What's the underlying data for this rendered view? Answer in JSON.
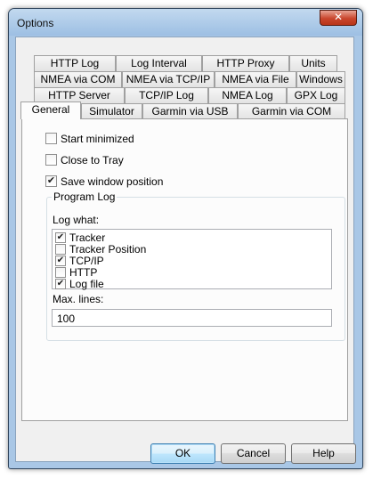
{
  "window": {
    "title": "Options",
    "close_glyph": "✕"
  },
  "tabs": {
    "row1": [
      "HTTP Log",
      "Log Interval",
      "HTTP Proxy",
      "Units"
    ],
    "row2": [
      "NMEA via COM",
      "NMEA via TCP/IP",
      "NMEA via File",
      "Windows"
    ],
    "row3": [
      "HTTP Server",
      "TCP/IP Log",
      "NMEA Log",
      "GPX Log"
    ],
    "row4": [
      "General",
      "Simulator",
      "Garmin via USB",
      "Garmin via COM"
    ],
    "active": "General"
  },
  "general": {
    "start_minimized": {
      "label": "Start minimized",
      "checked": false
    },
    "close_to_tray": {
      "label": "Close to Tray",
      "checked": false
    },
    "save_window_position": {
      "label": "Save window position",
      "checked": true
    }
  },
  "program_log": {
    "title": "Program Log",
    "log_what_label": "Log what:",
    "items": [
      {
        "label": "Tracker",
        "checked": true
      },
      {
        "label": "Tracker Position",
        "checked": false
      },
      {
        "label": "TCP/IP",
        "checked": true
      },
      {
        "label": "HTTP",
        "checked": false
      },
      {
        "label": "Log file",
        "checked": true
      }
    ],
    "max_lines_label": "Max. lines:",
    "max_lines_value": "100"
  },
  "buttons": {
    "ok": "OK",
    "cancel": "Cancel",
    "help": "Help"
  },
  "check_glyph": "✔"
}
